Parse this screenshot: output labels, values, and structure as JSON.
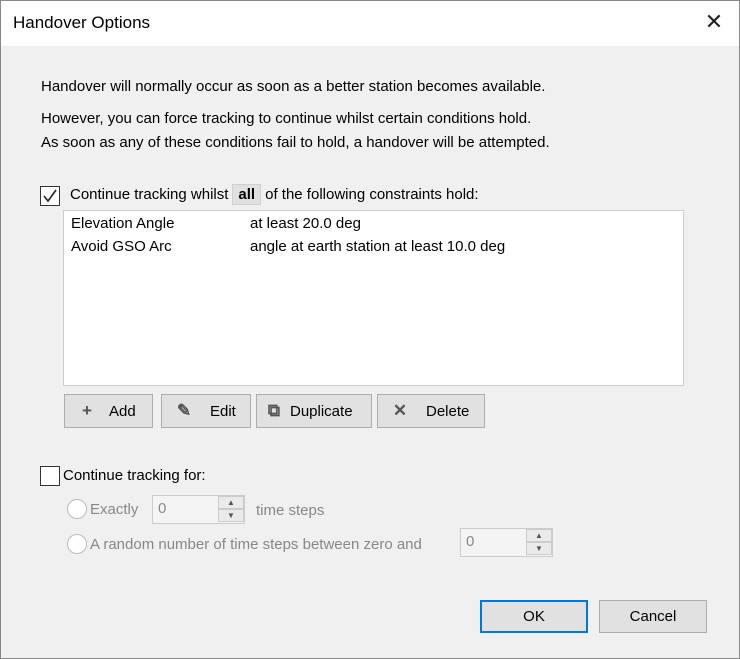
{
  "dialog": {
    "title": "Handover Options"
  },
  "intro": [
    "Handover will normally occur as soon as a better station becomes available.",
    "However, you can force tracking to continue whilst certain conditions hold.",
    "As soon as any of these conditions fail to hold, a handover will be attempted."
  ],
  "constraints": {
    "checked": true,
    "label_before": "Continue tracking whilst",
    "mode": "all",
    "label_after": "of the following constraints hold:",
    "rows": [
      {
        "name": "Elevation Angle",
        "value": "at least 20.0 deg"
      },
      {
        "name": "Avoid GSO Arc",
        "value": "angle at earth station at least 10.0 deg"
      }
    ]
  },
  "buttons": {
    "add": "Add",
    "edit": "Edit",
    "duplicate": "Duplicate",
    "delete": "Delete",
    "ok": "OK",
    "cancel": "Cancel"
  },
  "continue_for": {
    "checked": false,
    "label": "Continue tracking for:",
    "exactly_label": "Exactly",
    "exactly_value": "0",
    "time_steps": "time steps",
    "random_label": "A random number of time steps between zero and",
    "random_value": "0"
  }
}
